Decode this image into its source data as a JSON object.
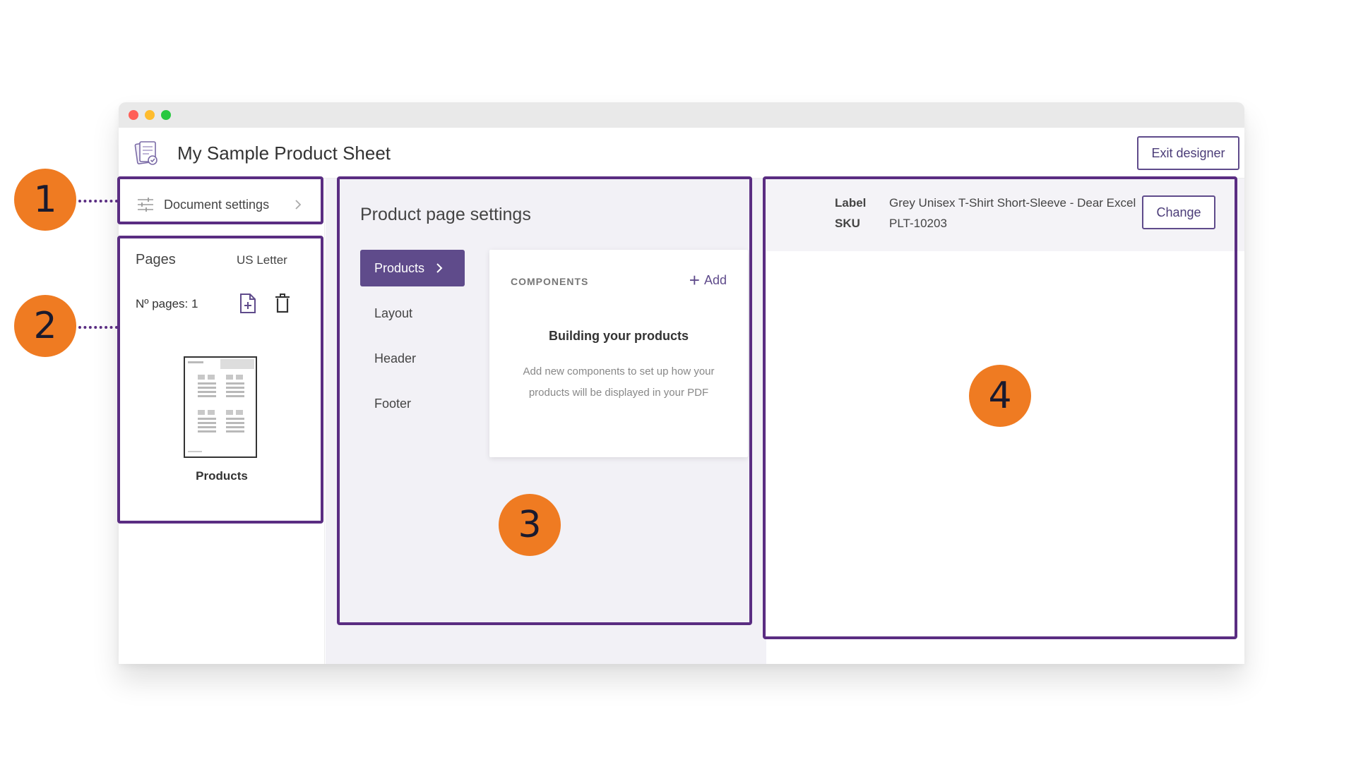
{
  "window": {
    "title": "My Sample Product Sheet",
    "exit_label": "Exit designer",
    "traffic_colors": {
      "close": "#ff5f57",
      "minimize": "#febc2e",
      "maximize": "#28c840"
    }
  },
  "colors": {
    "accent": "#5f4b8b",
    "highlight": "#5a2d82",
    "badge": "#ef7b22"
  },
  "sidebar": {
    "document_settings_label": "Document settings",
    "pages": {
      "title": "Pages",
      "size": "US Letter",
      "count_label": "Nº pages: 1",
      "thumb_label": "Products"
    }
  },
  "settings": {
    "title": "Product page settings",
    "menu": [
      {
        "label": "Products",
        "active": true
      },
      {
        "label": "Layout",
        "active": false
      },
      {
        "label": "Header",
        "active": false
      },
      {
        "label": "Footer",
        "active": false
      }
    ],
    "components": {
      "header": "COMPONENTS",
      "add_label": "Add",
      "empty_title": "Building your products",
      "empty_desc": "Add new components to set up how your products will be displayed in your PDF"
    }
  },
  "preview": {
    "label_key": "Label",
    "label_value": "Grey Unisex T-Shirt Short-Sleeve - Dear Excel",
    "sku_key": "SKU",
    "sku_value": "PLT-10203",
    "change_label": "Change"
  },
  "annotations": [
    "1",
    "2",
    "3",
    "4"
  ]
}
